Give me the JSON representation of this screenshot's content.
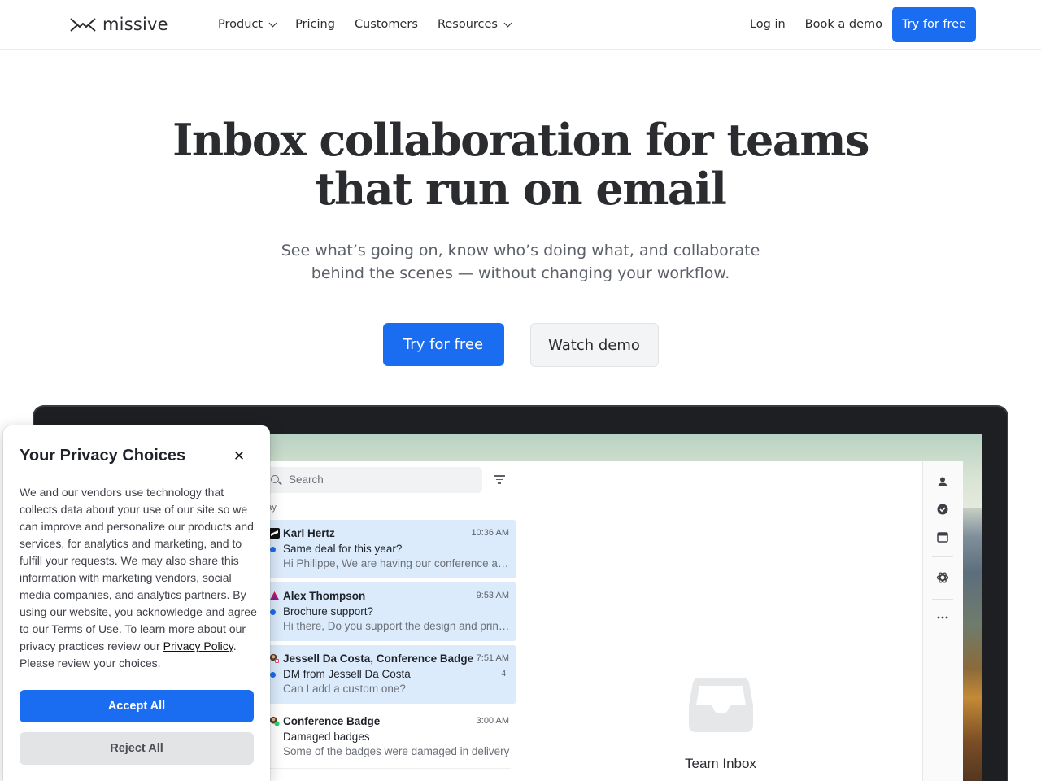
{
  "nav": {
    "logo_text": "missive",
    "links": [
      {
        "label": "Product",
        "dropdown": true
      },
      {
        "label": "Pricing",
        "dropdown": false
      },
      {
        "label": "Customers",
        "dropdown": false
      },
      {
        "label": "Resources",
        "dropdown": true
      }
    ],
    "login": "Log in",
    "book_demo": "Book a demo",
    "try_free": "Try for free"
  },
  "hero": {
    "title_line1": "Inbox collaboration for teams",
    "title_line2": "that run on email",
    "subtitle_line1": "See what’s going on, know who’s doing what, and collaborate",
    "subtitle_line2": "behind the scenes — without changing your workflow.",
    "primary_cta": "Try for free",
    "secondary_cta": "Watch demo"
  },
  "app_preview": {
    "search_placeholder": "Search",
    "day_label": "oday",
    "conversations": [
      {
        "from": "Karl Hertz",
        "time": "10:36 AM",
        "subject": "Same deal for this year?",
        "preview": "Hi Philippe, We are having our conference again this year",
        "unread": true,
        "selected": true,
        "count": ""
      },
      {
        "from": "Alex Thompson",
        "time": "9:53 AM",
        "subject": "Brochure support?",
        "preview": "Hi there, Do you support the design and printing of brochures",
        "unread": true,
        "selected": true,
        "count": ""
      },
      {
        "from": "Jessell Da Costa, Conference Badge",
        "time": "7:51 AM",
        "subject": "DM from Jessell Da Costa",
        "preview": "Can I add a custom one?",
        "unread": true,
        "selected": true,
        "count": "4"
      },
      {
        "from": "Conference Badge",
        "time": "3:00 AM",
        "subject": "Damaged badges",
        "preview": "Some of the badges were damaged in delivery",
        "unread": false,
        "selected": false,
        "count": ""
      }
    ],
    "empty_state_label": "Team Inbox",
    "accent_color": "#1a6cf0"
  },
  "privacy": {
    "title": "Your Privacy Choices",
    "close_icon": "close-icon",
    "body": "We and our vendors use technology that collects data about your use of our site so we can improve and personalize our products and services, for analytics and marketing, and to fulfill your requests. We may also share this information with marketing vendors, social media companies, and analytics partners. By using our website, you acknowledge and agree to our Terms of Use. To learn more about our privacy practices review our ",
    "policy_link": "Privacy Policy",
    "body_end": ". Please review your choices.",
    "accept": "Accept All",
    "reject": "Reject All"
  }
}
